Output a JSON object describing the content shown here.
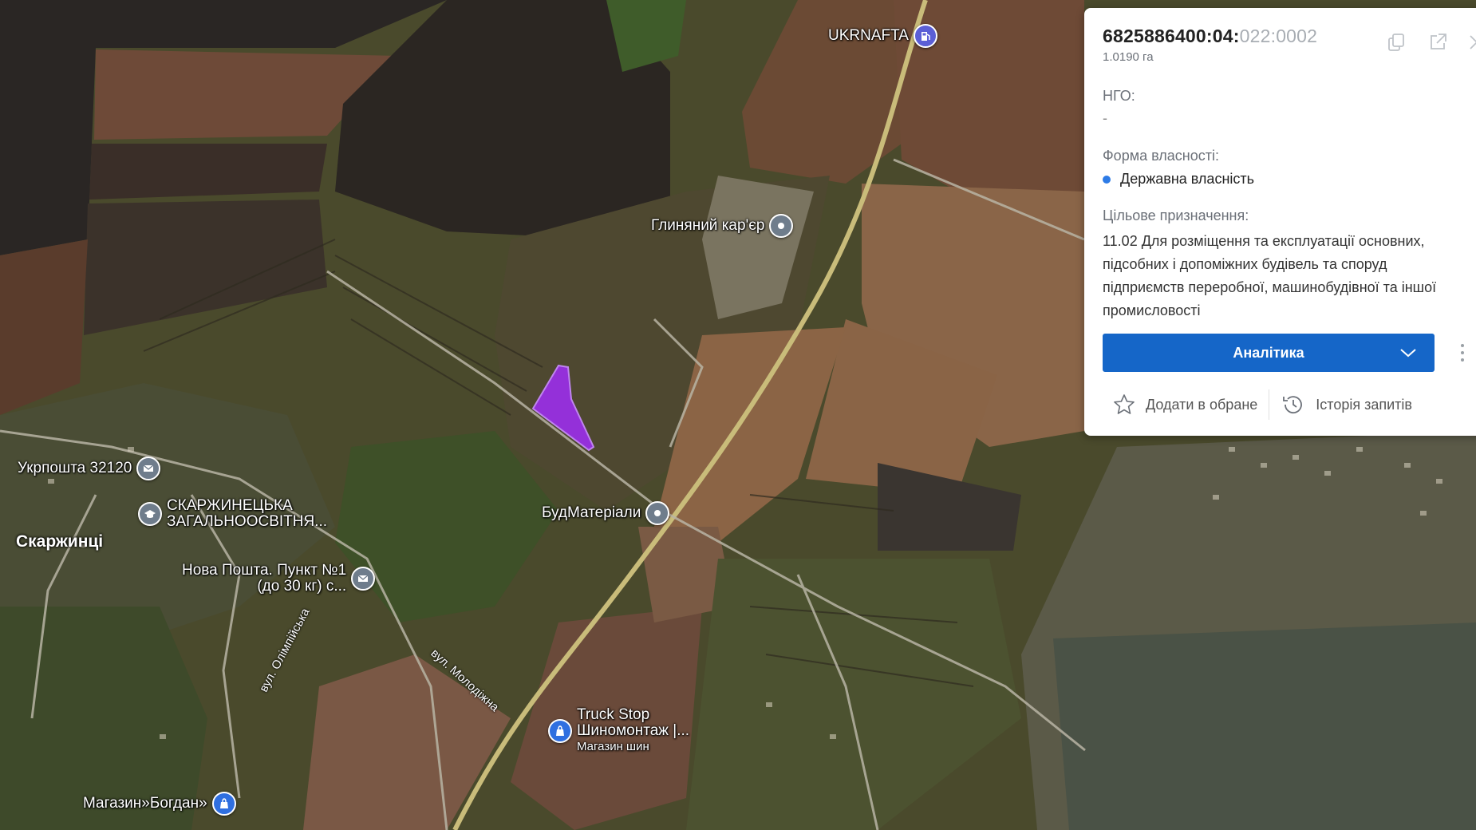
{
  "map": {
    "pois": [
      {
        "id": "ukrnafta",
        "label": "UKRNAFTA",
        "icon": "fuel-icon"
      },
      {
        "id": "clay-quarry",
        "label": "Глиняний кар'єр",
        "icon": "pin-dot-icon"
      },
      {
        "id": "ukrposhta",
        "label": "Укрпошта 32120",
        "icon": "mail-icon"
      },
      {
        "id": "school",
        "label": "СКАРЖИНЕЦЬКА",
        "label2": "ЗАГАЛЬНООСВІТНЯ...",
        "icon": "school-icon"
      },
      {
        "id": "budmaterialy",
        "label": "БудМатеріали",
        "icon": "pin-dot-icon"
      },
      {
        "id": "nova-poshta",
        "label": "Нова Пошта. Пункт №1",
        "label2": "(до 30 кг) с...",
        "icon": "mail-icon"
      },
      {
        "id": "truck-stop",
        "label": "Truck Stop",
        "label2": "Шиномонтаж |...",
        "label3": "Магазин шин",
        "icon": "shop-icon"
      },
      {
        "id": "bogdan",
        "label": "Магазин»Богдан»",
        "icon": "shop-icon"
      }
    ],
    "place_label": "Скаржинці",
    "roads": {
      "olimpiiska": "вул. Олімпійська",
      "molodizhna": "вул. Молодіжна"
    },
    "parcel_color": "#9a2fe8"
  },
  "panel": {
    "cadastral_main": "6825886400:04:",
    "cadastral_dim": "022:0002",
    "area": "1.0190 га",
    "ngo_label": "НГО:",
    "ngo_value": "-",
    "ownership_label": "Форма власності:",
    "ownership_value": "Державна власність",
    "purpose_label": "Цільове призначення:",
    "purpose_value": "11.02 Для розміщення та експлуатації основних, підсобних і допоміжних будівель та споруд підприємств переробної, машинобудівної та іншої промисловості",
    "analytics_button": "Аналітика",
    "favorite_label": "Додати в обране",
    "history_label": "Історія запитів",
    "accent": "#1566c8"
  }
}
